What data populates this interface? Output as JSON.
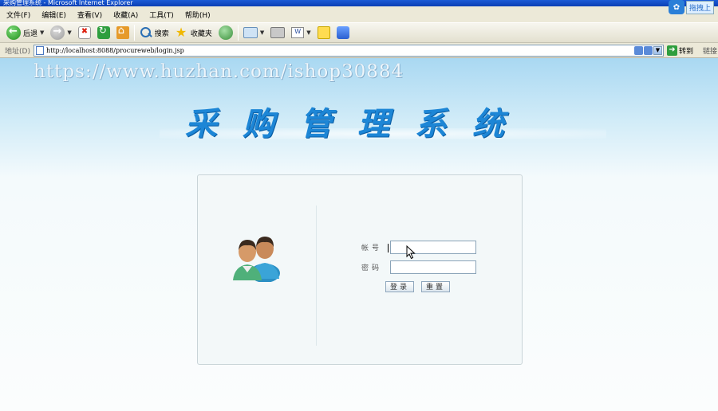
{
  "window": {
    "title": "采购管理系统 - Microsoft Internet Explorer"
  },
  "menu": [
    "文件(F)",
    "编辑(E)",
    "查看(V)",
    "收藏(A)",
    "工具(T)",
    "帮助(H)"
  ],
  "baidu_widget": {
    "label": "拖拽上"
  },
  "toolbar": {
    "back": "后退",
    "search": "搜索",
    "favorites": "收藏夹"
  },
  "address": {
    "label": "地址(D)",
    "url": "http://localhost:8088/procureweb/login.jsp",
    "go": "转到",
    "links": "链接"
  },
  "page": {
    "watermark": "https://www.huzhan.com/ishop30884",
    "system_title": "采购管理系统",
    "login": {
      "account_label": "帐号",
      "account_value": "",
      "password_label": "密码",
      "password_value": "",
      "login_button": "登录",
      "reset_button": "重置"
    }
  }
}
